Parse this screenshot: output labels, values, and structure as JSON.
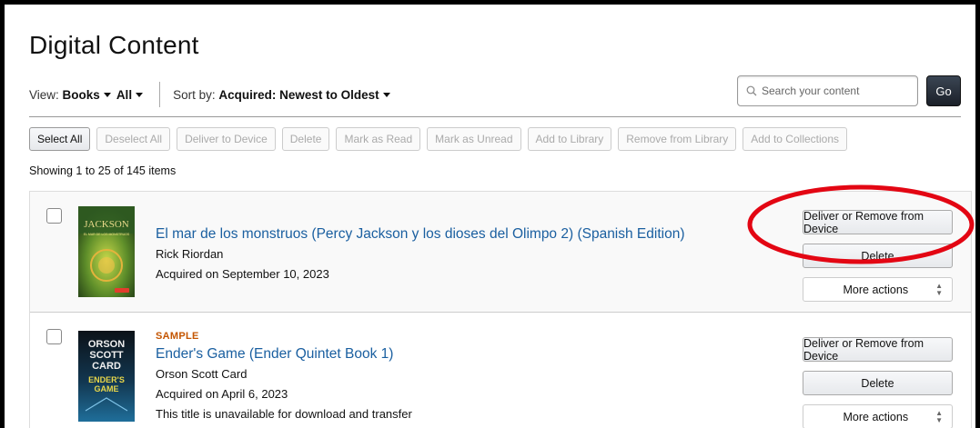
{
  "page": {
    "title": "Digital Content"
  },
  "toolbar": {
    "view_label": "View:",
    "view_type": "Books",
    "view_filter": "All",
    "sort_label": "Sort by:",
    "sort_value": "Acquired: Newest to Oldest",
    "search_placeholder": "Search your content",
    "go_label": "Go"
  },
  "actions": [
    {
      "label": "Select All",
      "enabled": true
    },
    {
      "label": "Deselect All",
      "enabled": false
    },
    {
      "label": "Deliver to Device",
      "enabled": false
    },
    {
      "label": "Delete",
      "enabled": false
    },
    {
      "label": "Mark as Read",
      "enabled": false
    },
    {
      "label": "Mark as Unread",
      "enabled": false
    },
    {
      "label": "Add to Library",
      "enabled": false
    },
    {
      "label": "Remove from Library",
      "enabled": false
    },
    {
      "label": "Add to Collections",
      "enabled": false
    }
  ],
  "count_text": "Showing 1 to 25 of 145 items",
  "items": [
    {
      "tag": "",
      "title": "El mar de los monstruos (Percy Jackson y los dioses del Olimpo 2) (Spanish Edition)",
      "author": "Rick Riordan",
      "acquired": "Acquired on September 10, 2023",
      "note": "",
      "cover": {
        "line1": "JACKSON",
        "line2": "EL MAR DE LOS MONSTRUOS",
        "colors": [
          "#3f6b28",
          "#9fbf3a",
          "#d98a1f"
        ]
      }
    },
    {
      "tag": "SAMPLE",
      "title": "Ender's Game (Ender Quintet Book 1)",
      "author": "Orson Scott Card",
      "acquired": "Acquired on April 6, 2023",
      "note": "This title is unavailable for download and transfer",
      "cover": {
        "line1": "ORSON",
        "line2": "SCOTT",
        "line3": "CARD",
        "line4": "ENDER'S",
        "line5": "GAME",
        "colors": [
          "#101820",
          "#1d6fa8",
          "#e2d14a"
        ]
      }
    }
  ],
  "item_buttons": {
    "deliver": "Deliver or Remove from Device",
    "delete": "Delete",
    "more": "More actions"
  },
  "colors": {
    "link": "#1a5fa0",
    "sample": "#c45500",
    "go_button": "#232f3e",
    "highlight": "#e30613"
  }
}
